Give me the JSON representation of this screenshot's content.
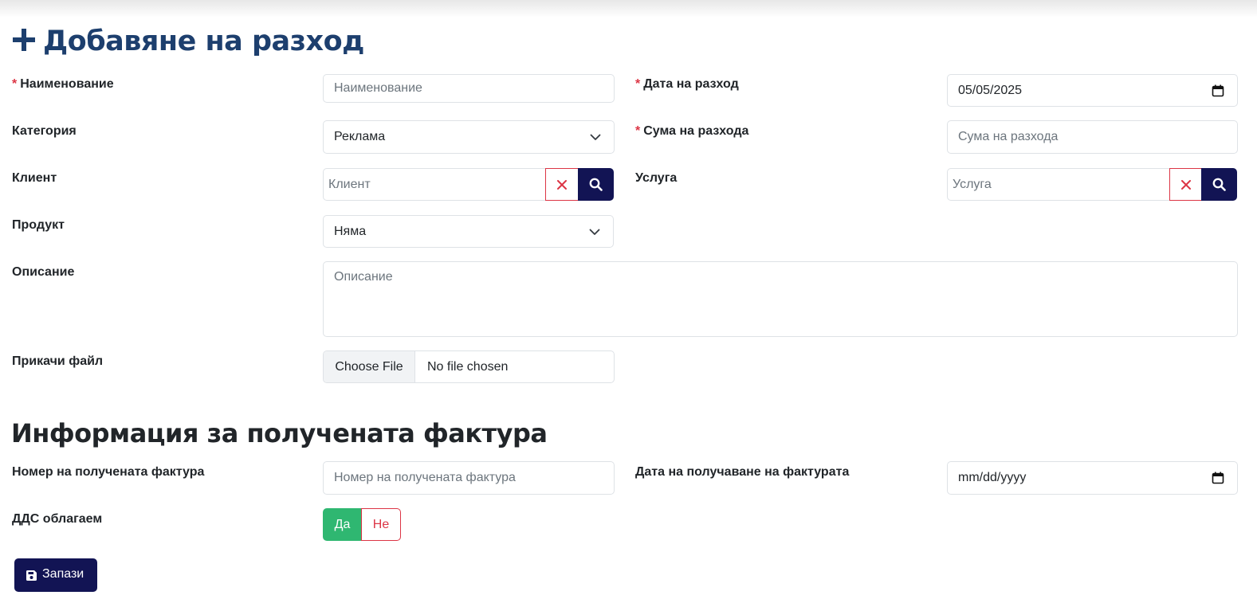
{
  "page_title": "Добавяне на разход",
  "icons": {
    "add": "plus-icon",
    "clear": "close-icon",
    "search": "search-icon",
    "dropdown": "chevron-down-icon",
    "calendar": "calendar-icon",
    "save": "floppy-disk-icon"
  },
  "colors": {
    "title": "#1d3f6e",
    "required": "#dc3545",
    "primary": "#121454",
    "success": "#2fb771",
    "danger": "#dc3545"
  },
  "required_mark": "*",
  "fields": {
    "name": {
      "label": "Наименование",
      "placeholder": "Наименование",
      "value": ""
    },
    "date": {
      "label": "Дата на разход",
      "value": "05/05/2025"
    },
    "category": {
      "label": "Категория",
      "selected": "Реклама"
    },
    "amount": {
      "label": "Сума на разхода",
      "placeholder": "Сума на разхода",
      "value": ""
    },
    "client": {
      "label": "Клиент",
      "placeholder": "Клиент",
      "value": ""
    },
    "service": {
      "label": "Услуга",
      "placeholder": "Услуга",
      "value": ""
    },
    "product": {
      "label": "Продукт",
      "selected": "Няма"
    },
    "description": {
      "label": "Описание",
      "placeholder": "Описание",
      "value": ""
    },
    "attachment": {
      "label": "Прикачи файл",
      "button": "Choose File",
      "status": "No file chosen"
    }
  },
  "invoice_section": {
    "title": "Информация за получената фактура",
    "number": {
      "label": "Номер на получената фактура",
      "placeholder": "Номер на получената фактура",
      "value": ""
    },
    "received_date": {
      "label": "Дата на получаване на фактурата",
      "value": "mm/dd/yyyy"
    },
    "vat": {
      "label": "ДДС облагаем",
      "yes": "Да",
      "no": "Не",
      "selected": "Да"
    }
  },
  "save_button": "Запази"
}
